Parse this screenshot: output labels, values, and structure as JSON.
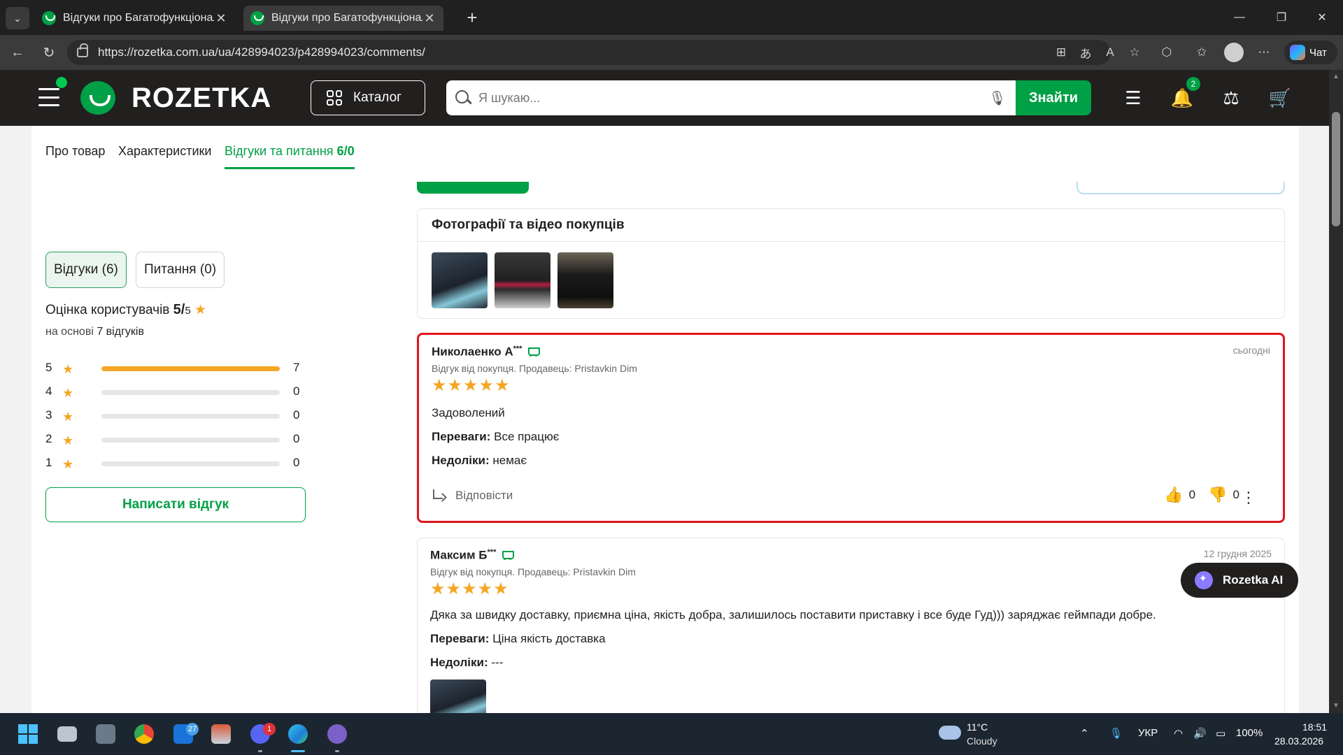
{
  "browser": {
    "tabs": [
      {
        "title": "Відгуки про Багатофункціональна"
      },
      {
        "title": "Відгуки про Багатофункціональна"
      }
    ],
    "url": "https://rozetka.com.ua/ua/428994023/p428994023/comments/",
    "copilot_label": "Чат"
  },
  "header": {
    "logo": "ROZETKA",
    "catalog_label": "Каталог",
    "search_placeholder": "Я шукаю...",
    "find_label": "Знайти",
    "notifications_count": "2"
  },
  "product_tabs": {
    "about": "Про товар",
    "specs": "Характеристики",
    "reviews": "Відгуки та питання",
    "reviews_count": "6/0"
  },
  "sidebar": {
    "reviews_pill": "Відгуки (6)",
    "questions_pill": "Питання (0)",
    "rating_label": "Оцінка користувачів",
    "rating_value": "5/",
    "rating_max": "5",
    "based_on": "на основі",
    "based_count": "7 відгуків",
    "distribution": [
      {
        "stars": "5",
        "count": "7",
        "fraction": 1.0
      },
      {
        "stars": "4",
        "count": "0",
        "fraction": 0
      },
      {
        "stars": "3",
        "count": "0",
        "fraction": 0
      },
      {
        "stars": "2",
        "count": "0",
        "fraction": 0
      },
      {
        "stars": "1",
        "count": "0",
        "fraction": 0
      }
    ],
    "write_review": "Написати відгук"
  },
  "media": {
    "title": "Фотографії та відео покупців"
  },
  "reviews": [
    {
      "author": "Николаенко А",
      "author_mask": "***",
      "date": "сьогодні",
      "meta": "Відгук від покупця. Продавець: Pristavkin Dim",
      "rating": 5,
      "text": "Задоволений",
      "pros_label": "Переваги:",
      "pros": "Все працює",
      "cons_label": "Недоліки:",
      "cons": "немає",
      "reply_label": "Відповісти",
      "likes": "0",
      "dislikes": "0"
    },
    {
      "author": "Максим Б",
      "author_mask": "***",
      "date": "12 грудня 2025",
      "meta": "Відгук від покупця. Продавець: Pristavkin Dim",
      "rating": 5,
      "text": "Дяка за швидку доставку, приємна ціна, якість добра, залишилось поставити приставку і все буде Гуд))) заряджає геймпади добре.",
      "pros_label": "Переваги:",
      "pros": "Ціна якість доставка",
      "cons_label": "Недоліки:",
      "cons": "---"
    }
  ],
  "ai_button": "Rozetka AI",
  "taskbar": {
    "badges": {
      "outlook": "27",
      "discord": "1"
    },
    "weather_temp": "11°C",
    "weather_cond": "Cloudy",
    "lang": "УКР",
    "battery": "100%",
    "time": "18:51",
    "date": "28.03.2026"
  },
  "colors": {
    "brand_green": "#00a046",
    "header_dark": "#221f1f",
    "star": "#f5a623",
    "highlight_red": "#e0161c"
  }
}
